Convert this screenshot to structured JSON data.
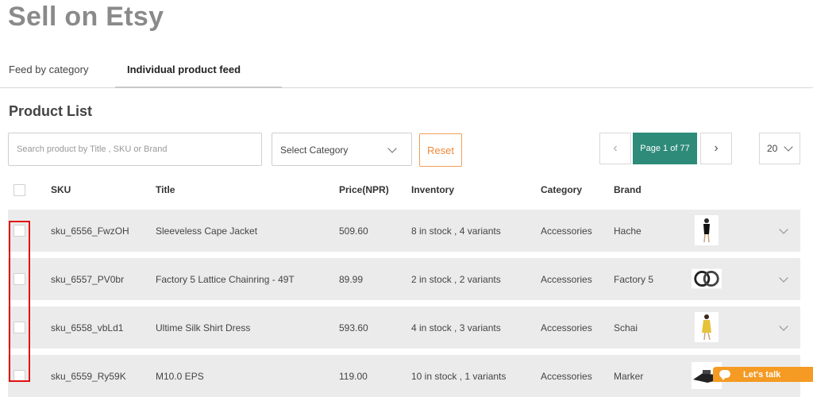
{
  "page": {
    "title": "Sell on Etsy"
  },
  "tabs": [
    {
      "label": "Feed by category",
      "active": false
    },
    {
      "label": "Individual product feed",
      "active": true
    }
  ],
  "product_list": {
    "title": "Product List",
    "search_placeholder": "Search product by Title , SKU or Brand",
    "category_select": "Select Category",
    "reset_label": "Reset",
    "pagination": {
      "prev": "‹",
      "label": "Page 1 of 77",
      "next": "›"
    },
    "per_page": "20"
  },
  "table": {
    "headers": {
      "sku": "SKU",
      "title": "Title",
      "price": "Price(NPR)",
      "inventory": "Inventory",
      "category": "Category",
      "brand": "Brand"
    },
    "rows": [
      {
        "sku": "sku_6556_FwzOH",
        "title": "Sleeveless Cape Jacket",
        "price": "509.60",
        "inventory": "8 in stock , 4 variants",
        "category": "Accessories",
        "brand": "Hache",
        "thumb": "model-black-dress"
      },
      {
        "sku": "sku_6557_PV0br",
        "title": "Factory 5 Lattice Chainring - 49T",
        "price": "89.99",
        "inventory": "2 in stock , 2 variants",
        "category": "Accessories",
        "brand": "Factory 5",
        "thumb": "chainrings"
      },
      {
        "sku": "sku_6558_vbLd1",
        "title": "Ultime Silk Shirt Dress",
        "price": "593.60",
        "inventory": "4 in stock , 3 variants",
        "category": "Accessories",
        "brand": "Schai",
        "thumb": "model-yellow-dress"
      },
      {
        "sku": "sku_6559_Ry59K",
        "title": "M10.0 EPS",
        "price": "119.00",
        "inventory": "10 in stock , 1 variants",
        "category": "Accessories",
        "brand": "Marker",
        "thumb": "ski-binding"
      }
    ]
  },
  "chat": {
    "label": "Let's talk"
  },
  "colors": {
    "accent": "#2e8b7a",
    "reset": "#ee8a3a",
    "chat": "#f59a23",
    "highlight": "#e01010"
  }
}
